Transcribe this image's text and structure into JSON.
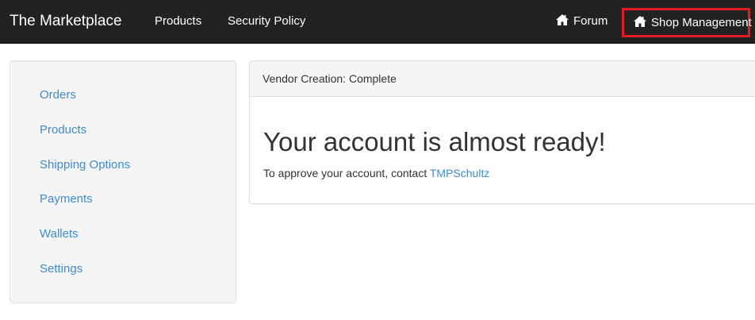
{
  "navbar": {
    "brand": "The Marketplace",
    "links": [
      "Products",
      "Security Policy"
    ],
    "right_links": [
      {
        "label": "Forum",
        "icon": "home-icon"
      },
      {
        "label": "Shop Management",
        "icon": "home-icon",
        "highlight_color": "#e11b22"
      }
    ]
  },
  "sidebar": {
    "items": [
      "Orders",
      "Products",
      "Shipping Options",
      "Payments",
      "Wallets",
      "Settings"
    ]
  },
  "panel": {
    "heading": "Vendor Creation: Complete",
    "title": "Your account is almost ready!",
    "text_prefix": "To approve your account, contact ",
    "contact_link": "TMPSchultz"
  },
  "colors": {
    "navbar_bg": "#222222",
    "link": "#428bca",
    "highlight": "#e11b22"
  }
}
